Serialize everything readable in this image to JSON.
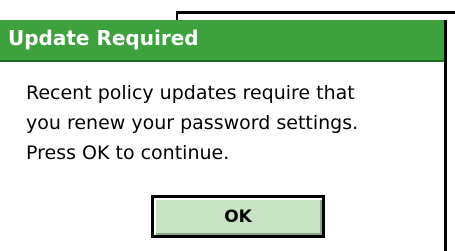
{
  "dialog": {
    "title": "Update Required",
    "message_lines": [
      "Recent policy updates require that",
      "you renew your password settings.",
      "Press OK to continue."
    ],
    "ok_label": "OK"
  },
  "colors": {
    "titlebar": "#3da13d",
    "button_fill": "#c8e3c4"
  }
}
